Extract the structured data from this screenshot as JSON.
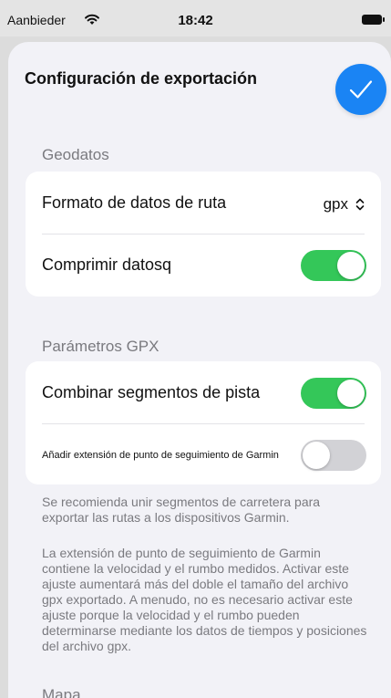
{
  "status_bar": {
    "carrier": "Aanbieder",
    "time": "18:42"
  },
  "sheet": {
    "title": "Configuración de exportación",
    "done_icon": "checkmark-icon"
  },
  "sections": {
    "geodata": {
      "header": "Geodatos",
      "route_format": {
        "label": "Formato de datos de ruta",
        "value": "gpx"
      },
      "compress": {
        "label": "Comprimir datosq",
        "on": true
      }
    },
    "gpx": {
      "header": "Parámetros GPX",
      "merge_segments": {
        "label": "Combinar segmentos de pista",
        "on": true
      },
      "garmin_extension": {
        "label": "Añadir extensión de punto de seguimiento de Garmin",
        "on": false
      },
      "footnote_1": "Se recomienda unir segmentos de carretera para exportar las rutas a los dispositivos Garmin.",
      "footnote_2": "La extensión de punto de seguimiento de Garmin contiene la velocidad y el rumbo medidos. Activar este ajuste aumentará más del doble el tamaño del archivo gpx exportado. A menudo, no es necesario activar este ajuste porque la velocidad y el rumbo pueden determinarse mediante los datos de tiempos y posiciones del archivo gpx."
    },
    "map": {
      "header": "Mapa"
    }
  },
  "colors": {
    "accent": "#1a84f4",
    "toggle_on": "#34c759",
    "toggle_off": "#d2d2d6"
  }
}
